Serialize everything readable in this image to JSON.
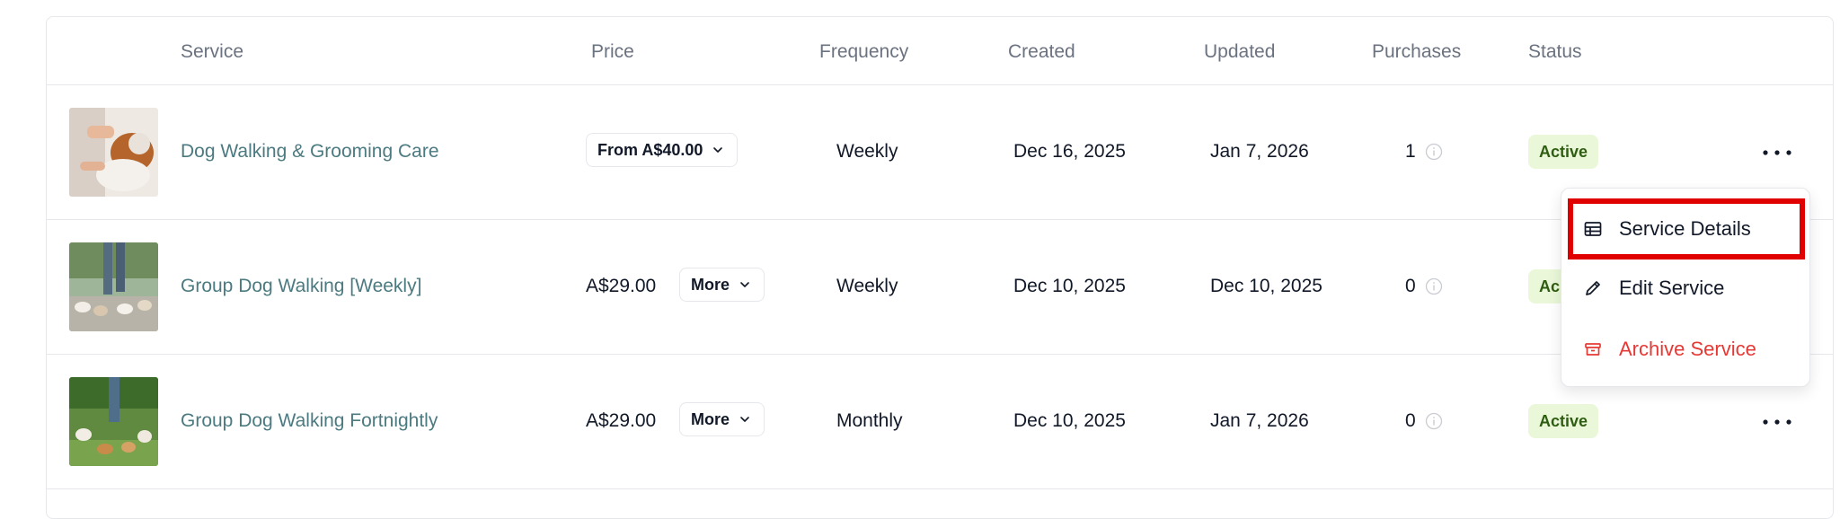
{
  "columns": {
    "service": "Service",
    "price": "Price",
    "frequency": "Frequency",
    "created": "Created",
    "updated": "Updated",
    "purchases": "Purchases",
    "status": "Status"
  },
  "rows": [
    {
      "name": "Dog Walking & Grooming Care",
      "price_label": "From A$40.00",
      "frequency": "Weekly",
      "created": "Dec 16, 2025",
      "updated": "Jan 7, 2026",
      "purchases": "1",
      "status": "Active"
    },
    {
      "name": "Group Dog Walking [Weekly]",
      "price": "A$29.00",
      "more_label": "More",
      "frequency": "Weekly",
      "created": "Dec 10, 2025",
      "updated": "Dec 10, 2025",
      "purchases": "0",
      "status": "Ac"
    },
    {
      "name": "Group Dog Walking Fortnightly",
      "price": "A$29.00",
      "more_label": "More",
      "frequency": "Monthly",
      "created": "Dec 10, 2025",
      "updated": "Jan 7, 2026",
      "purchases": "0",
      "status": "Active"
    }
  ],
  "menu": {
    "service_details": "Service Details",
    "edit_service": "Edit Service",
    "archive_service": "Archive Service"
  },
  "colors": {
    "link": "#4b7a80",
    "badge_bg": "#eaf8d9",
    "danger": "#e53935",
    "highlight": "#e00000"
  },
  "icons": [
    "info-icon",
    "chevron-down-icon",
    "more-dots-icon",
    "table-icon",
    "pencil-icon",
    "archive-icon"
  ]
}
